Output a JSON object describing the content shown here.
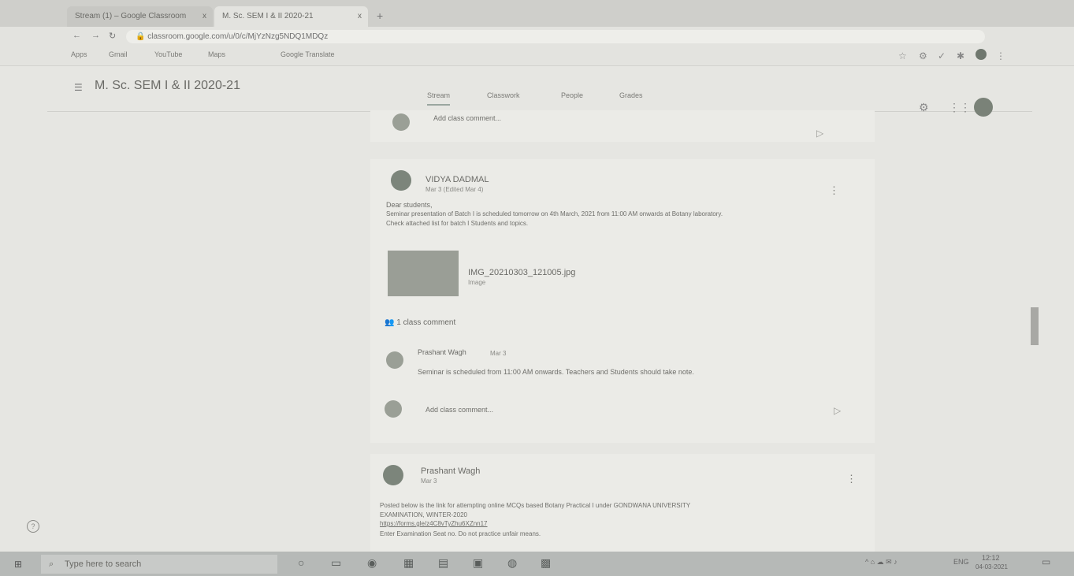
{
  "browser": {
    "tabs": [
      {
        "label": "Stream (1) – Google Classroom"
      },
      {
        "label": "M. Sc. SEM I & II 2020-21"
      }
    ],
    "new_tab_label": "+",
    "close_label": "x",
    "url": "classroom.google.com/u/0/c/MjYzNzg5NDQ1MDQz",
    "bookmarks": [
      "Apps",
      "Gmail",
      "YouTube",
      "Maps",
      "Google Translate"
    ]
  },
  "classroom": {
    "title": "M. Sc. SEM I & II 2020-21",
    "tabs": [
      "Stream",
      "Classwork",
      "People",
      "Grades"
    ],
    "active_tab": "Stream"
  },
  "stream": {
    "top_comment_placeholder": "Add class comment...",
    "posts": [
      {
        "author": "VIDYA DADMAL",
        "date": "Mar 3 (Edited Mar 4)",
        "greeting": "Dear students,",
        "line1": "Seminar presentation of Batch I is scheduled tomorrow on 4th March, 2021 from 11:00 AM onwards at Botany laboratory.",
        "line2": "Check attached list for batch I Students and topics.",
        "attachment": {
          "name": "IMG_20210303_121005.jpg",
          "type": "Image"
        },
        "class_comments": "1 class comment",
        "comment": {
          "author": "Prashant Wagh",
          "date": "Mar 3",
          "text": "Seminar is scheduled from 11:00 AM onwards. Teachers and Students should take note."
        },
        "comment_placeholder": "Add class comment..."
      },
      {
        "author": "Prashant Wagh",
        "date": "Mar 3",
        "line1": "Posted below is the link for attempting online MCQs based Botany Practical I under GONDWANA UNIVERSITY",
        "line2": "EXAMINATION, WINTER-2020",
        "link": "https://forms.gle/z4C8vTyZhu6XZnn17",
        "line3": "Enter Examination Seat no. Do not practice unfair means."
      }
    ]
  },
  "taskbar": {
    "search_placeholder": "Type here to search",
    "tray_lang": "ENG",
    "tray_time": "12:12",
    "tray_date": "04-03-2021"
  },
  "help_label": "?"
}
